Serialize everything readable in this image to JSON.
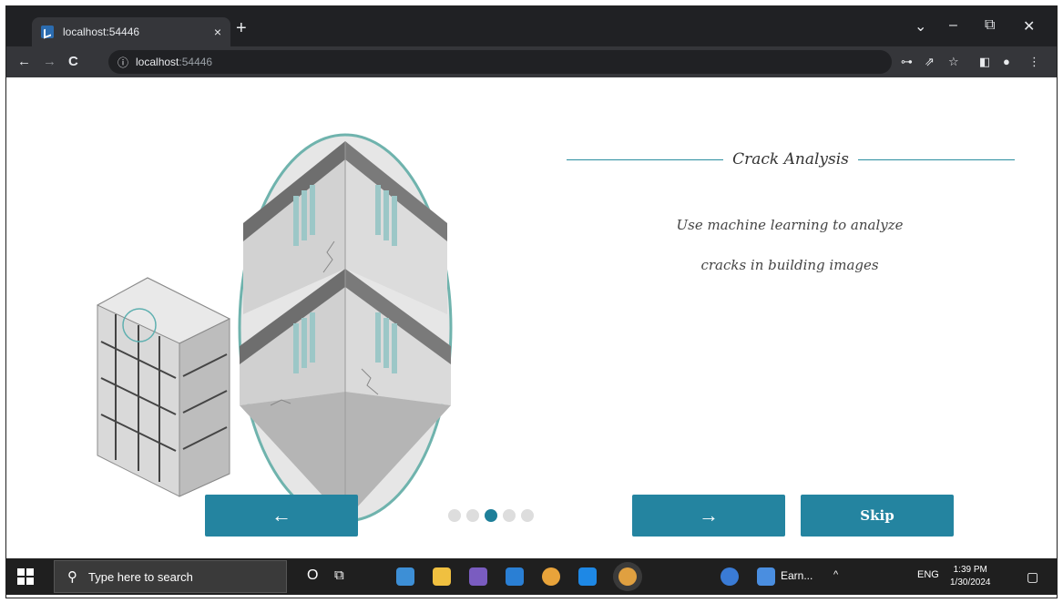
{
  "browser": {
    "tab_title": "localhost:54446",
    "tab_close": "×",
    "new_tab": "+",
    "url_host": "localhost",
    "url_port": ":54446",
    "nav_back": "←",
    "nav_forward": "→",
    "reload": "C",
    "info": "ⓘ",
    "window_controls": {
      "menu": "⌄",
      "minimize": "–",
      "restore": "⧉",
      "close": "✕"
    },
    "toolbar_icons": {
      "key": "⊶",
      "share": "⇗",
      "star": "☆",
      "sidebar": "◧",
      "profile": "●",
      "menu": "⋮"
    }
  },
  "onboarding": {
    "title": "Crack Analysis",
    "subtitle_line1": "Use machine learning to analyze",
    "subtitle_line2": "cracks in building images",
    "back_label": "←",
    "next_label": "→",
    "skip_label": "Skip",
    "page_count": 5,
    "active_page": 3,
    "accent_color": "#2484a0"
  },
  "taskbar": {
    "search_placeholder": "Type here to search",
    "search_icon": "⚲",
    "cortana": "O",
    "task_view": "⧉",
    "app_label": "Earn...",
    "tray_chevron": "^",
    "language": "ENG",
    "time": "1:39 PM",
    "date": "1/30/2024"
  }
}
